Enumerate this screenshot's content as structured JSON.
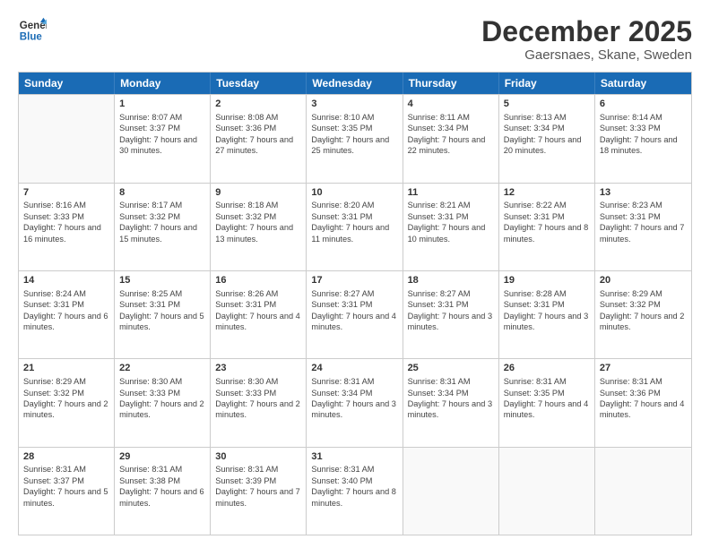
{
  "logo": {
    "line1": "General",
    "line2": "Blue"
  },
  "title": "December 2025",
  "location": "Gaersnaes, Skane, Sweden",
  "days": [
    "Sunday",
    "Monday",
    "Tuesday",
    "Wednesday",
    "Thursday",
    "Friday",
    "Saturday"
  ],
  "weeks": [
    [
      {
        "num": "",
        "sunrise": "",
        "sunset": "",
        "daylight": ""
      },
      {
        "num": "1",
        "sunrise": "Sunrise: 8:07 AM",
        "sunset": "Sunset: 3:37 PM",
        "daylight": "Daylight: 7 hours and 30 minutes."
      },
      {
        "num": "2",
        "sunrise": "Sunrise: 8:08 AM",
        "sunset": "Sunset: 3:36 PM",
        "daylight": "Daylight: 7 hours and 27 minutes."
      },
      {
        "num": "3",
        "sunrise": "Sunrise: 8:10 AM",
        "sunset": "Sunset: 3:35 PM",
        "daylight": "Daylight: 7 hours and 25 minutes."
      },
      {
        "num": "4",
        "sunrise": "Sunrise: 8:11 AM",
        "sunset": "Sunset: 3:34 PM",
        "daylight": "Daylight: 7 hours and 22 minutes."
      },
      {
        "num": "5",
        "sunrise": "Sunrise: 8:13 AM",
        "sunset": "Sunset: 3:34 PM",
        "daylight": "Daylight: 7 hours and 20 minutes."
      },
      {
        "num": "6",
        "sunrise": "Sunrise: 8:14 AM",
        "sunset": "Sunset: 3:33 PM",
        "daylight": "Daylight: 7 hours and 18 minutes."
      }
    ],
    [
      {
        "num": "7",
        "sunrise": "Sunrise: 8:16 AM",
        "sunset": "Sunset: 3:33 PM",
        "daylight": "Daylight: 7 hours and 16 minutes."
      },
      {
        "num": "8",
        "sunrise": "Sunrise: 8:17 AM",
        "sunset": "Sunset: 3:32 PM",
        "daylight": "Daylight: 7 hours and 15 minutes."
      },
      {
        "num": "9",
        "sunrise": "Sunrise: 8:18 AM",
        "sunset": "Sunset: 3:32 PM",
        "daylight": "Daylight: 7 hours and 13 minutes."
      },
      {
        "num": "10",
        "sunrise": "Sunrise: 8:20 AM",
        "sunset": "Sunset: 3:31 PM",
        "daylight": "Daylight: 7 hours and 11 minutes."
      },
      {
        "num": "11",
        "sunrise": "Sunrise: 8:21 AM",
        "sunset": "Sunset: 3:31 PM",
        "daylight": "Daylight: 7 hours and 10 minutes."
      },
      {
        "num": "12",
        "sunrise": "Sunrise: 8:22 AM",
        "sunset": "Sunset: 3:31 PM",
        "daylight": "Daylight: 7 hours and 8 minutes."
      },
      {
        "num": "13",
        "sunrise": "Sunrise: 8:23 AM",
        "sunset": "Sunset: 3:31 PM",
        "daylight": "Daylight: 7 hours and 7 minutes."
      }
    ],
    [
      {
        "num": "14",
        "sunrise": "Sunrise: 8:24 AM",
        "sunset": "Sunset: 3:31 PM",
        "daylight": "Daylight: 7 hours and 6 minutes."
      },
      {
        "num": "15",
        "sunrise": "Sunrise: 8:25 AM",
        "sunset": "Sunset: 3:31 PM",
        "daylight": "Daylight: 7 hours and 5 minutes."
      },
      {
        "num": "16",
        "sunrise": "Sunrise: 8:26 AM",
        "sunset": "Sunset: 3:31 PM",
        "daylight": "Daylight: 7 hours and 4 minutes."
      },
      {
        "num": "17",
        "sunrise": "Sunrise: 8:27 AM",
        "sunset": "Sunset: 3:31 PM",
        "daylight": "Daylight: 7 hours and 4 minutes."
      },
      {
        "num": "18",
        "sunrise": "Sunrise: 8:27 AM",
        "sunset": "Sunset: 3:31 PM",
        "daylight": "Daylight: 7 hours and 3 minutes."
      },
      {
        "num": "19",
        "sunrise": "Sunrise: 8:28 AM",
        "sunset": "Sunset: 3:31 PM",
        "daylight": "Daylight: 7 hours and 3 minutes."
      },
      {
        "num": "20",
        "sunrise": "Sunrise: 8:29 AM",
        "sunset": "Sunset: 3:32 PM",
        "daylight": "Daylight: 7 hours and 2 minutes."
      }
    ],
    [
      {
        "num": "21",
        "sunrise": "Sunrise: 8:29 AM",
        "sunset": "Sunset: 3:32 PM",
        "daylight": "Daylight: 7 hours and 2 minutes."
      },
      {
        "num": "22",
        "sunrise": "Sunrise: 8:30 AM",
        "sunset": "Sunset: 3:33 PM",
        "daylight": "Daylight: 7 hours and 2 minutes."
      },
      {
        "num": "23",
        "sunrise": "Sunrise: 8:30 AM",
        "sunset": "Sunset: 3:33 PM",
        "daylight": "Daylight: 7 hours and 2 minutes."
      },
      {
        "num": "24",
        "sunrise": "Sunrise: 8:31 AM",
        "sunset": "Sunset: 3:34 PM",
        "daylight": "Daylight: 7 hours and 3 minutes."
      },
      {
        "num": "25",
        "sunrise": "Sunrise: 8:31 AM",
        "sunset": "Sunset: 3:34 PM",
        "daylight": "Daylight: 7 hours and 3 minutes."
      },
      {
        "num": "26",
        "sunrise": "Sunrise: 8:31 AM",
        "sunset": "Sunset: 3:35 PM",
        "daylight": "Daylight: 7 hours and 4 minutes."
      },
      {
        "num": "27",
        "sunrise": "Sunrise: 8:31 AM",
        "sunset": "Sunset: 3:36 PM",
        "daylight": "Daylight: 7 hours and 4 minutes."
      }
    ],
    [
      {
        "num": "28",
        "sunrise": "Sunrise: 8:31 AM",
        "sunset": "Sunset: 3:37 PM",
        "daylight": "Daylight: 7 hours and 5 minutes."
      },
      {
        "num": "29",
        "sunrise": "Sunrise: 8:31 AM",
        "sunset": "Sunset: 3:38 PM",
        "daylight": "Daylight: 7 hours and 6 minutes."
      },
      {
        "num": "30",
        "sunrise": "Sunrise: 8:31 AM",
        "sunset": "Sunset: 3:39 PM",
        "daylight": "Daylight: 7 hours and 7 minutes."
      },
      {
        "num": "31",
        "sunrise": "Sunrise: 8:31 AM",
        "sunset": "Sunset: 3:40 PM",
        "daylight": "Daylight: 7 hours and 8 minutes."
      },
      {
        "num": "",
        "sunrise": "",
        "sunset": "",
        "daylight": ""
      },
      {
        "num": "",
        "sunrise": "",
        "sunset": "",
        "daylight": ""
      },
      {
        "num": "",
        "sunrise": "",
        "sunset": "",
        "daylight": ""
      }
    ]
  ]
}
